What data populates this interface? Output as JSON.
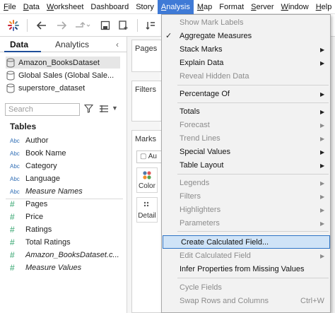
{
  "menubar": {
    "items": [
      {
        "label": "File",
        "key": "F",
        "rest": "ile"
      },
      {
        "label": "Data",
        "key": "D",
        "rest": "ata"
      },
      {
        "label": "Worksheet",
        "key": "W",
        "rest": "orksheet"
      },
      {
        "label": "Dashboard",
        "key": "",
        "rest": "Dashboard"
      },
      {
        "label": "Story",
        "key": "",
        "rest": "Story"
      },
      {
        "label": "Analysis",
        "key": "A",
        "rest": "nalysis"
      },
      {
        "label": "Map",
        "key": "M",
        "rest": "ap"
      },
      {
        "label": "Format",
        "key": "",
        "rest": "Format"
      },
      {
        "label": "Server",
        "key": "S",
        "rest": "erver"
      },
      {
        "label": "Window",
        "key": "W",
        "rest": "indow"
      },
      {
        "label": "Help",
        "key": "H",
        "rest": "elp"
      }
    ]
  },
  "toolbar": {
    "icons": [
      "tableau-logo-icon",
      "undo-icon",
      "redo-icon",
      "replay-icon",
      "save-icon",
      "new-datasource-icon",
      "swap-icon"
    ]
  },
  "left_pane": {
    "tabs": {
      "data": "Data",
      "analytics": "Analytics"
    },
    "datasources": [
      "Amazon_BooksDataset",
      "Global Sales (Global Sale...",
      "superstore_dataset"
    ],
    "search_placeholder": "Search",
    "tables_heading": "Tables",
    "dimensions": [
      {
        "type": "Abc",
        "name": "Author",
        "italic": false
      },
      {
        "type": "Abc",
        "name": "Book Name",
        "italic": false
      },
      {
        "type": "Abc",
        "name": "Category",
        "italic": false
      },
      {
        "type": "Abc",
        "name": "Language",
        "italic": false
      },
      {
        "type": "Abc",
        "name": "Measure Names",
        "italic": true
      }
    ],
    "measures": [
      {
        "type": "#",
        "name": "Pages",
        "italic": false
      },
      {
        "type": "#",
        "name": "Price",
        "italic": false
      },
      {
        "type": "#",
        "name": "Ratings",
        "italic": false
      },
      {
        "type": "#",
        "name": "Total Ratings",
        "italic": false
      },
      {
        "type": "#",
        "name": "Amazon_BooksDataset.c...",
        "italic": true
      },
      {
        "type": "#",
        "name": "Measure Values",
        "italic": true
      }
    ]
  },
  "shelves": {
    "pages": "Pages",
    "filters": "Filters",
    "marks": "Marks",
    "marks_type": "Au",
    "color": "Color",
    "detail": "Detail"
  },
  "analysis_menu": {
    "items": [
      {
        "label": "Show Mark Labels",
        "disabled": true,
        "submenu": false,
        "checked": false
      },
      {
        "label": "Aggregate Measures",
        "disabled": false,
        "submenu": false,
        "checked": true
      },
      {
        "label": "Stack Marks",
        "disabled": false,
        "submenu": true,
        "checked": false
      },
      {
        "label": "Explain Data",
        "disabled": false,
        "submenu": true,
        "checked": false
      },
      {
        "label": "Reveal Hidden Data",
        "disabled": true,
        "submenu": false,
        "checked": false
      },
      {
        "label": "Percentage Of",
        "disabled": false,
        "submenu": true,
        "checked": false
      },
      {
        "label": "Totals",
        "disabled": false,
        "submenu": true,
        "checked": false
      },
      {
        "label": "Forecast",
        "disabled": true,
        "submenu": true,
        "checked": false
      },
      {
        "label": "Trend Lines",
        "disabled": true,
        "submenu": true,
        "checked": false
      },
      {
        "label": "Special Values",
        "disabled": false,
        "submenu": true,
        "checked": false
      },
      {
        "label": "Table Layout",
        "disabled": false,
        "submenu": true,
        "checked": false
      },
      {
        "label": "Legends",
        "disabled": true,
        "submenu": true,
        "checked": false
      },
      {
        "label": "Filters",
        "disabled": true,
        "submenu": true,
        "checked": false
      },
      {
        "label": "Highlighters",
        "disabled": true,
        "submenu": true,
        "checked": false
      },
      {
        "label": "Parameters",
        "disabled": true,
        "submenu": true,
        "checked": false
      },
      {
        "label": "Create Calculated Field...",
        "disabled": false,
        "submenu": false,
        "checked": false,
        "highlight": true
      },
      {
        "label": "Edit Calculated Field",
        "disabled": true,
        "submenu": true,
        "checked": false
      },
      {
        "label": "Infer Properties from Missing Values",
        "disabled": false,
        "submenu": false,
        "checked": false
      },
      {
        "label": "Cycle Fields",
        "disabled": true,
        "submenu": false,
        "checked": false
      },
      {
        "label": "Swap Rows and Columns",
        "disabled": true,
        "submenu": false,
        "checked": false,
        "shortcut": "Ctrl+W"
      }
    ],
    "arrow_glyph": "▶",
    "check_glyph": "✓"
  },
  "colors": {
    "menu_active": "#3f7ad6",
    "highlight_bg": "#cfe3f7",
    "highlight_border": "#2e74c6",
    "dimension_blue": "#2f6db5",
    "measure_green": "#2fa36b"
  }
}
